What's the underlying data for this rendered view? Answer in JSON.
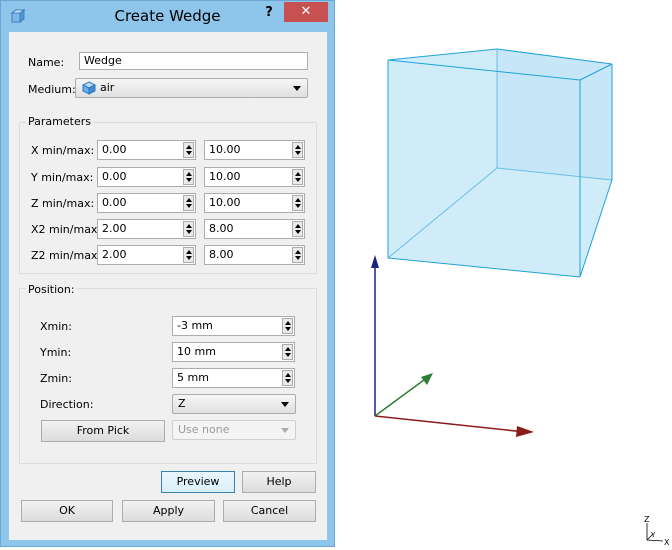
{
  "dialog": {
    "title": "Create Wedge",
    "help_glyph": "?",
    "close_glyph": "✕",
    "name_label": "Name:",
    "name_value": "Wedge",
    "medium_label": "Medium:",
    "medium_value": "air",
    "parameters": {
      "title": "Parameters",
      "rows": [
        {
          "label": "X min/max:",
          "min": "0.00",
          "max": "10.00"
        },
        {
          "label": "Y min/max:",
          "min": "0.00",
          "max": "10.00"
        },
        {
          "label": "Z min/max:",
          "min": "0.00",
          "max": "10.00"
        },
        {
          "label": "X2 min/max:",
          "min": "2.00",
          "max": "8.00"
        },
        {
          "label": "Z2 min/max:",
          "min": "2.00",
          "max": "8.00"
        }
      ]
    },
    "position": {
      "title": "Position:",
      "xmin_label": "Xmin:",
      "xmin_value": "-3 mm",
      "ymin_label": "Ymin:",
      "ymin_value": "10 mm",
      "zmin_label": "Zmin:",
      "zmin_value": "5 mm",
      "direction_label": "Direction:",
      "direction_value": "Z",
      "from_pick_label": "From Pick",
      "use_value": "Use none"
    },
    "buttons": {
      "preview": "Preview",
      "help": "Help",
      "ok": "OK",
      "apply": "Apply",
      "cancel": "Cancel"
    }
  },
  "viewport": {
    "axis_colors": {
      "x": "#8b1a1a",
      "y": "#2e7d32",
      "z": "#1a237e"
    },
    "wedge_fill": "#c9e9f8",
    "wedge_edge": "#1fa3d8",
    "triad": {
      "z_label": "Z",
      "y_label": "Y",
      "x_label": "X"
    }
  }
}
